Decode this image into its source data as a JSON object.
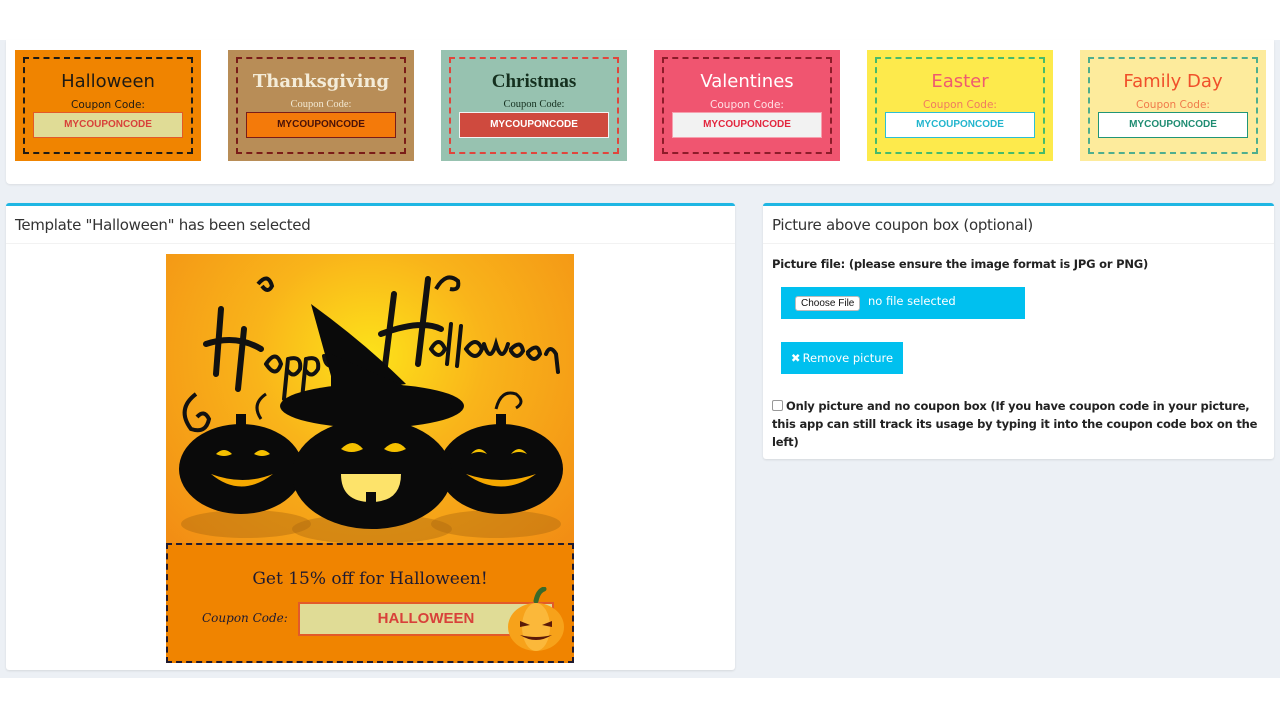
{
  "templates": [
    {
      "name": "Halloween",
      "coupon_label": "Coupon Code:",
      "code": "MYCOUPONCODE"
    },
    {
      "name": "Thanksgiving",
      "coupon_label": "Coupon Code:",
      "code": "MYCOUPONCODE"
    },
    {
      "name": "Christmas",
      "coupon_label": "Coupon Code:",
      "code": "MYCOUPONCODE"
    },
    {
      "name": "Valentines",
      "coupon_label": "Coupon Code:",
      "code": "MYCOUPONCODE"
    },
    {
      "name": "Easter",
      "coupon_label": "Coupon Code:",
      "code": "MYCOUPONCODE"
    },
    {
      "name": "Family Day",
      "coupon_label": "Coupon Code:",
      "code": "MYCOUPONCODE"
    }
  ],
  "preview_panel": {
    "title": "Template \"Halloween\" has been selected",
    "hero_image": "happy-halloween-pumpkins-witch-hat",
    "coupon": {
      "headline": "Get 15% off for Halloween!",
      "label": "Coupon Code:",
      "code": "HALLOWEEN"
    }
  },
  "picture_panel": {
    "title": "Picture above coupon box (optional)",
    "file_label": "Picture file: (please ensure the image format is JPG or PNG)",
    "choose_file_button": "Choose File",
    "file_status": "no file selected",
    "remove_button": "Remove picture",
    "remove_icon": "times-icon",
    "only_picture_checkbox": {
      "checked": false,
      "label": "Only picture and no coupon box (If you have coupon code in your picture, this app can still track its usage by typing it into the coupon code box on the left)"
    }
  },
  "colors": {
    "accent": "#00c0ef",
    "panel_border": "#1fb6e3",
    "page_bg": "#ecf0f5"
  }
}
